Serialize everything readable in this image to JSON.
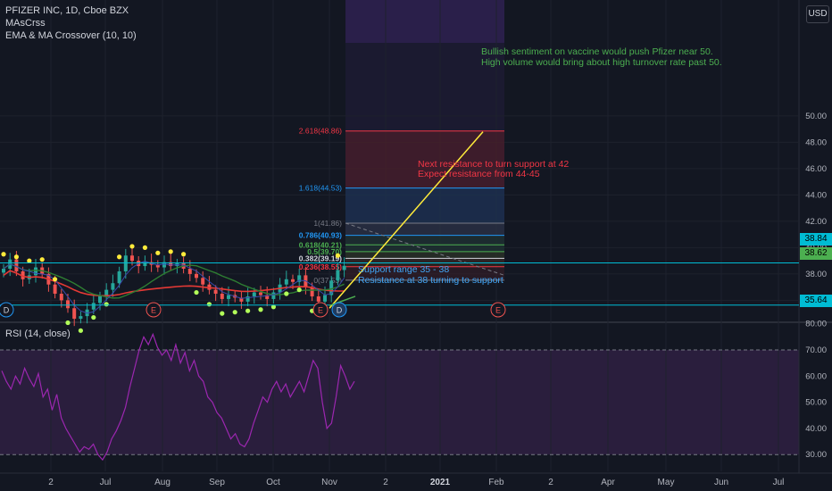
{
  "header": {
    "symbol": "PFIZER INC, 1D, Cboe BZX",
    "indicators": [
      "MAsCrss",
      "EMA & MA Crossover (10, 10)"
    ],
    "currency": "USD"
  },
  "rsi_panel": {
    "label": "RSI (14, close)"
  },
  "colors": {
    "background": "#131722",
    "fib_line": "#f23645",
    "fib_blue": "#2196f3",
    "annotation_green": "#4caf50",
    "annotation_red": "#f23645",
    "annotation_blue": "#42a5f5",
    "trendline": "#ffeb3b",
    "cyan": "#00bcd4",
    "rsi": "#9c27b0"
  },
  "price_labels": [
    {
      "text": "38.84",
      "value": 38.84,
      "color": "#00bcd4"
    },
    {
      "text": "38.62",
      "value": 38.62,
      "color": "#4caf50"
    },
    {
      "text": "35.64",
      "value": 35.64,
      "color": "#00bcd4"
    }
  ],
  "chart_data": [
    {
      "type": "candlestick",
      "ylim": [
        34.4,
        51
      ],
      "y_ticks": [
        "36.00",
        "38.00",
        "40.00",
        "42.00",
        "44.00",
        "46.00",
        "48.00",
        "50.00"
      ],
      "x_ticks": [
        "2",
        "Jul",
        "Aug",
        "Sep",
        "Oct",
        "Nov",
        "2",
        "2021",
        "Feb",
        "2",
        "Apr",
        "May",
        "Jun",
        "Jul"
      ],
      "fib_levels": [
        {
          "ratio_label": "2.618(48.86)",
          "value": 48.86,
          "color": "#f23645"
        },
        {
          "ratio_label": "1.618(44.53)",
          "value": 44.53,
          "color": "#2196f3"
        },
        {
          "ratio_label": "1(41.86)",
          "value": 41.86,
          "color": "#787b86"
        },
        {
          "ratio_label": "0.786(40.93)",
          "value": 40.93,
          "color": "#2196f3"
        },
        {
          "ratio_label": "0.618(40.21)",
          "value": 40.21,
          "color": "#4caf50"
        },
        {
          "ratio_label": "0.5(39.70)",
          "value": 39.7,
          "color": "#4caf50"
        },
        {
          "ratio_label": "0.382(39.19)",
          "value": 39.19,
          "color": "#d1d4dc"
        },
        {
          "ratio_label": "0.236(38.55)",
          "value": 38.55,
          "color": "#f23645"
        },
        {
          "ratio_label": "0(37.53)",
          "value": 37.53,
          "color": "#787b86"
        }
      ],
      "horizontal_lines": [
        38.84,
        35.64
      ],
      "annotations": [
        {
          "text": "Bullish sentiment on vaccine would push Pfizer near 50.",
          "color": "#4caf50"
        },
        {
          "text": "High volume would bring about high turnover rate past 50.",
          "color": "#4caf50"
        },
        {
          "text": "Next resistance to turn support at 42",
          "color": "#f23645"
        },
        {
          "text": "Expect resistance from 44-45",
          "color": "#f23645"
        },
        {
          "text": "Support range 35 - 38",
          "color": "#42a5f5"
        },
        {
          "text": "Resistance at 38 turning to support",
          "color": "#42a5f5"
        }
      ],
      "event_markers": [
        "D",
        "E",
        "E",
        "D",
        "E"
      ],
      "closes": [
        38.4,
        39.1,
        38.2,
        37.6,
        37.9,
        38.5,
        38.0,
        37.2,
        36.5,
        36.0,
        35.4,
        34.6,
        34.8,
        35.3,
        35.8,
        36.3,
        36.8,
        37.3,
        38.2,
        39.4,
        39.0,
        38.6,
        38.9,
        38.7,
        38.5,
        38.9,
        38.6,
        38.8,
        38.4,
        38.0,
        37.7,
        37.2,
        36.8,
        36.5,
        36.1,
        36.4,
        36.2,
        35.9,
        36.3,
        36.6,
        36.4,
        36.1,
        36.6,
        37.2,
        37.6,
        37.4,
        37.9,
        37.0,
        36.3,
        35.9,
        36.4,
        37.5,
        38.3,
        38.62
      ],
      "trendline": {
        "from": 35.4,
        "to": 48.8
      }
    },
    {
      "type": "line",
      "title": "RSI (14, close)",
      "ylim": [
        25,
        83
      ],
      "y_ticks": [
        "30.00",
        "40.00",
        "50.00",
        "60.00",
        "70.00",
        "80.00"
      ],
      "bands": [
        30,
        70
      ],
      "values": [
        62,
        58,
        55,
        60,
        57,
        63,
        59,
        56,
        61,
        52,
        55,
        47,
        53,
        44,
        40,
        37,
        34,
        31,
        33,
        32,
        34,
        30,
        28,
        31,
        36,
        39,
        43,
        48,
        56,
        63,
        70,
        75,
        72,
        76,
        71,
        68,
        70,
        66,
        72,
        65,
        69,
        62,
        66,
        60,
        58,
        52,
        50,
        46,
        44,
        40,
        36,
        38,
        34,
        33,
        36,
        42,
        47,
        52,
        50,
        55,
        58,
        54,
        57,
        52,
        55,
        58,
        54,
        60,
        66,
        63,
        50,
        40,
        42,
        52,
        64,
        60,
        55,
        58
      ]
    }
  ]
}
